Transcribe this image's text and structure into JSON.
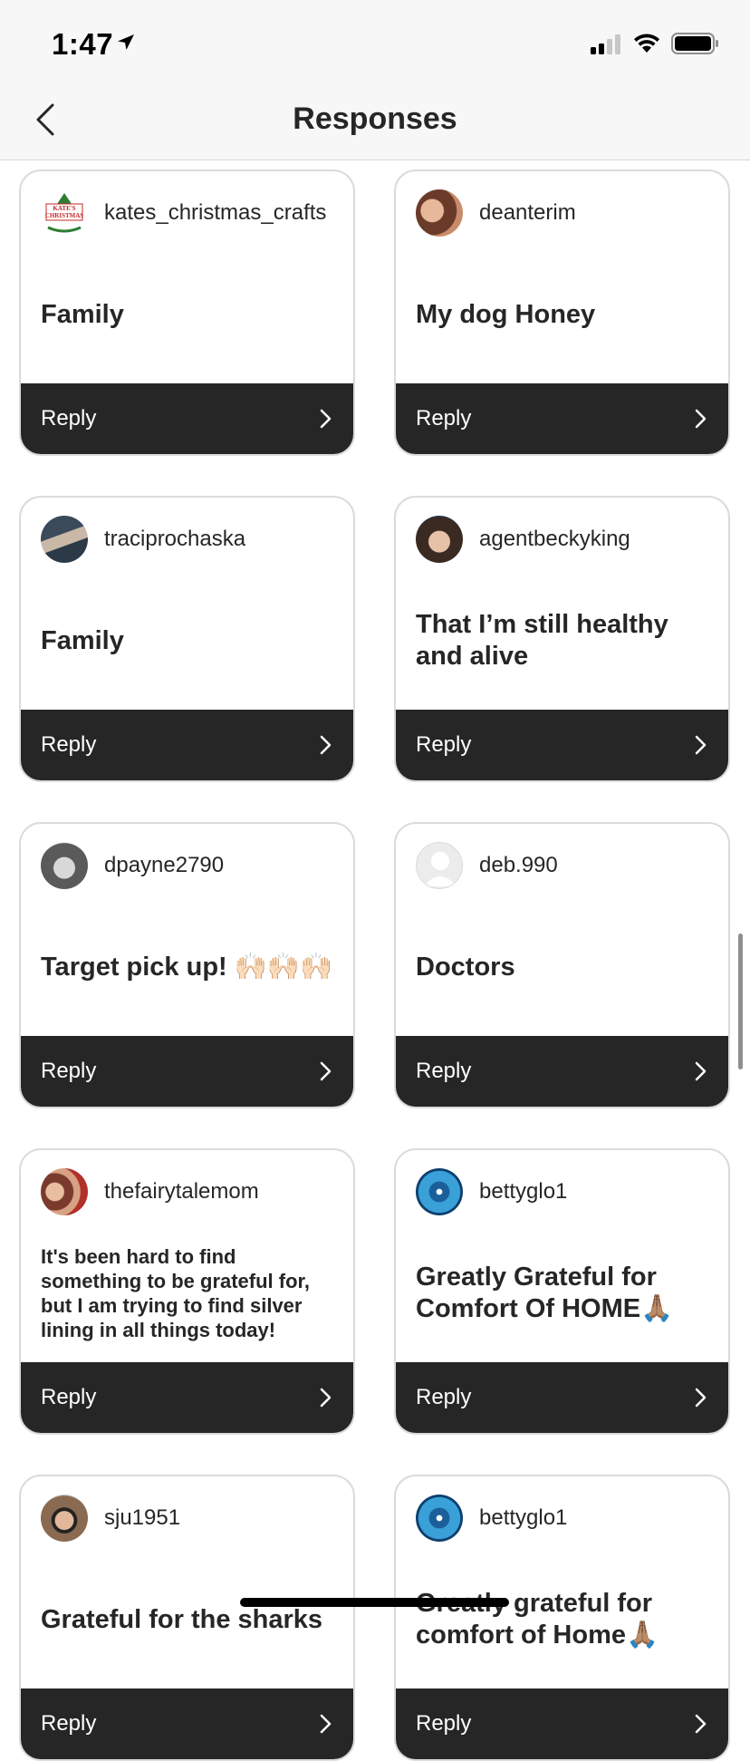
{
  "status_bar": {
    "time": "1:47"
  },
  "header": {
    "title": "Responses"
  },
  "reply_label": "Reply",
  "cards": [
    {
      "username": "kates_christmas_crafts",
      "text": "Family"
    },
    {
      "username": "deanterim",
      "text": "My dog Honey"
    },
    {
      "username": "traciprochaska",
      "text": "Family"
    },
    {
      "username": "agentbeckyking",
      "text": "That I’m still healthy and alive"
    },
    {
      "username": "dpayne2790",
      "text": "Target pick up! 🙌🏻🙌🏻🙌🏻"
    },
    {
      "username": "deb.990",
      "text": "Doctors"
    },
    {
      "username": "thefairytalemom",
      "text": "It's been hard to find something to be grateful for, but I am trying to find silver lining in all things today!"
    },
    {
      "username": "bettyglo1",
      "text": "Greatly Grateful for Comfort Of  HOME🙏🏽"
    },
    {
      "username": "sju1951",
      "text": "Grateful for the sharks"
    },
    {
      "username": "bettyglo1",
      "text": "Greatly grateful for comfort of Home🙏🏽"
    }
  ],
  "colors": {
    "reply_bar": "#262626",
    "card_border": "#dbdbdb",
    "header_bg": "#f7f7f7"
  }
}
